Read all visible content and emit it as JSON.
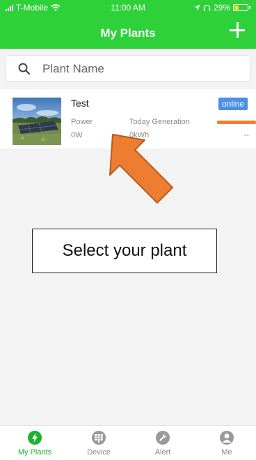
{
  "status_bar": {
    "carrier": "T-Mobile",
    "time": "11:00 AM",
    "battery": "29%"
  },
  "header": {
    "title": "My Plants"
  },
  "search": {
    "placeholder": "Plant Name"
  },
  "plants": [
    {
      "name": "Test",
      "status": "online",
      "power_label": "Power",
      "power_value": "0W",
      "generation_label": "Today Generation",
      "generation_value": "0kWh",
      "extra_value": "--"
    }
  ],
  "callout": {
    "text": "Select your plant"
  },
  "tabs": [
    {
      "label": "My Plants",
      "icon": "lightning-icon"
    },
    {
      "label": "Device",
      "icon": "device-icon"
    },
    {
      "label": "Alert",
      "icon": "wrench-icon"
    },
    {
      "label": "Me",
      "icon": "person-icon"
    }
  ],
  "colors": {
    "header": "#2fd13a",
    "active_tab": "#1fb02b",
    "status_badge": "#4a8fe8",
    "arrow": "#ee7d31"
  }
}
